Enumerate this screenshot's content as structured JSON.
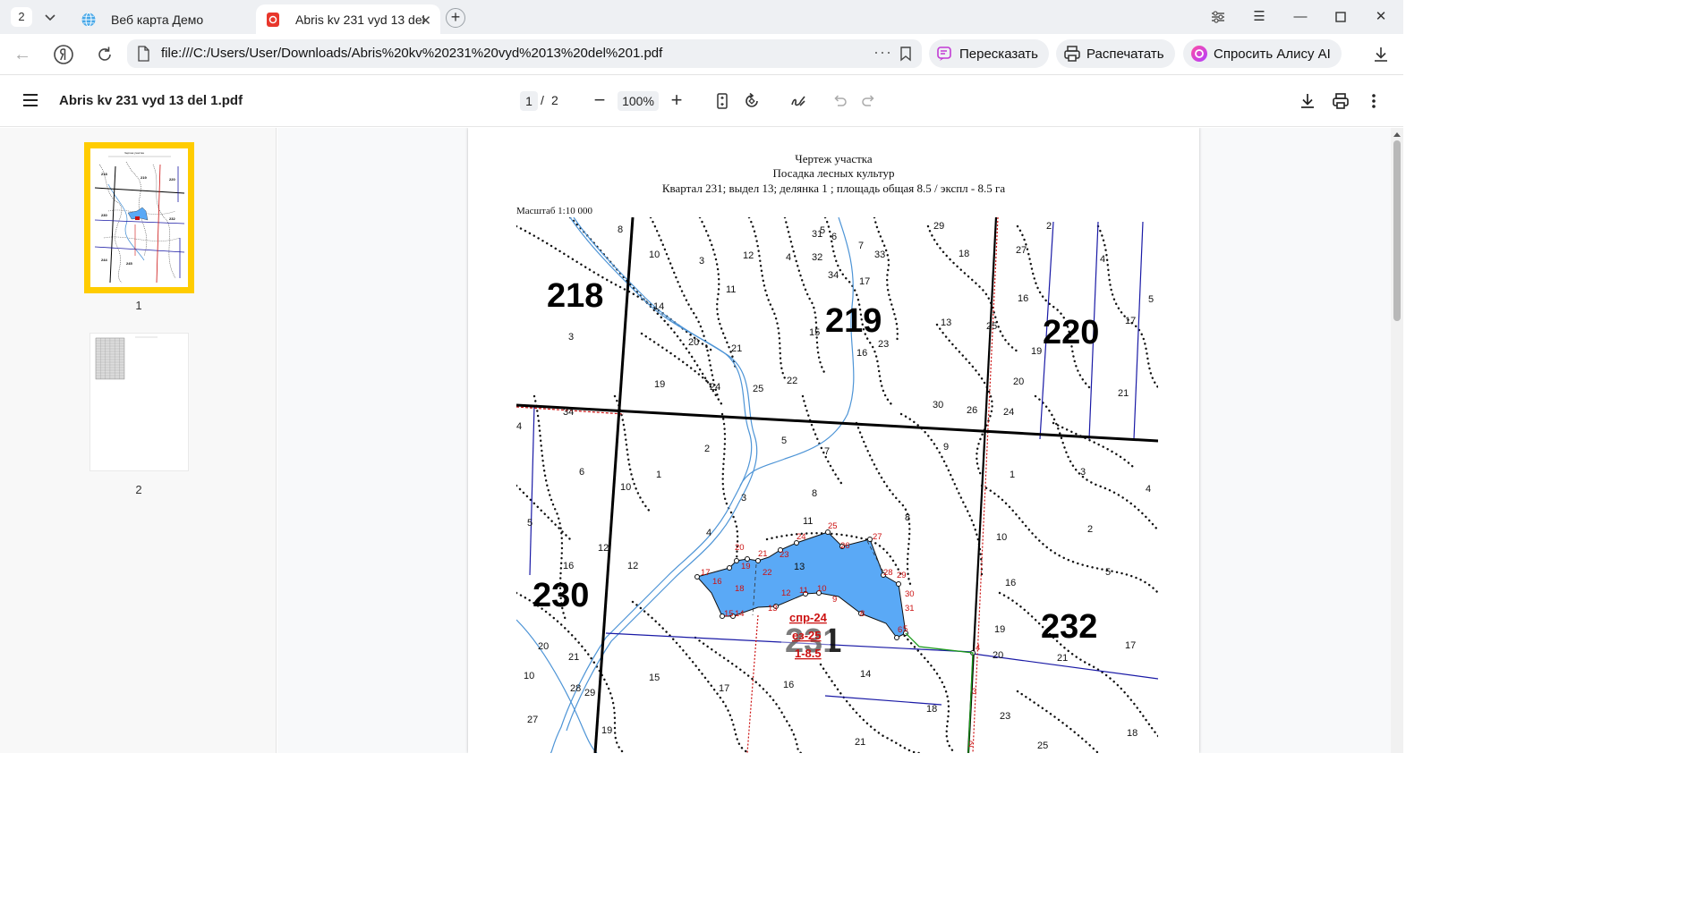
{
  "tabs": {
    "count": "2",
    "items": [
      {
        "title": "Веб карта Демо"
      },
      {
        "title": "Abris kv 231 vyd 13 del"
      }
    ]
  },
  "address": {
    "url": "file:///C:/Users/User/Downloads/Abris%20kv%20231%20vyd%2013%20del%201.pdf",
    "more": "···"
  },
  "actions": {
    "summarize": "Пересказать",
    "print": "Распечатать",
    "ask_alice": "Спросить Алису AI"
  },
  "pdf_toolbar": {
    "filename": "Abris kv 231 vyd 13 del 1.pdf",
    "current_page": "1",
    "separator": "/",
    "total_pages": "2",
    "zoom": "100%"
  },
  "thumbnails": [
    {
      "label": "1"
    },
    {
      "label": "2"
    }
  ],
  "document": {
    "title_line1": "Чертеж участка",
    "title_line2": "Посадка лесных культур",
    "title_line3": "Квартал 231; выдел 13; делянка 1 ; площадь общая 8.5 / экспл - 8.5 га",
    "scale": "Масштаб   1:10 000",
    "quarters": [
      "218",
      "219",
      "220",
      "230",
      "232"
    ],
    "plot_label": [
      "спр-24",
      "ез-25",
      "1-8.5"
    ],
    "plot_points": [
      "1",
      "2",
      "3",
      "4",
      "5",
      "6",
      "7",
      "8",
      "9",
      "10",
      "11",
      "12",
      "13",
      "14",
      "15",
      "16",
      "17",
      "18",
      "19",
      "20",
      "21",
      "22",
      "23",
      "24",
      "25",
      "26",
      "27",
      "28",
      "29",
      "30",
      "31"
    ],
    "colors": {
      "plot_fill": "#5aa9f6",
      "quarter_line": "#000000",
      "subdivision_line": "#1a1aa6",
      "red_line": "#cc1111",
      "stream": "#4d94d6"
    }
  }
}
